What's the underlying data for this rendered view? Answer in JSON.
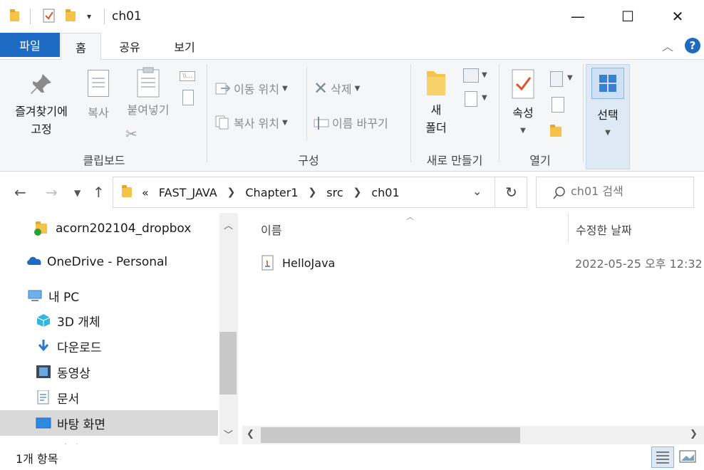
{
  "window": {
    "title": "ch01",
    "minimize": "—",
    "maximize": "☐",
    "close": "✕"
  },
  "tabs": {
    "file": "파일",
    "home": "홈",
    "share": "공유",
    "view": "보기",
    "help": "?"
  },
  "ribbon": {
    "clipboard": {
      "label": "클립보드",
      "pin": "즐겨찾기에\n고정",
      "copy": "복사",
      "paste": "붙여넣기"
    },
    "organize": {
      "label": "구성",
      "move_to": "이동 위치",
      "copy_to": "복사 위치",
      "delete": "삭제",
      "rename": "이름 바꾸기"
    },
    "new": {
      "label": "새로 만들기",
      "new_folder": "새\n폴더"
    },
    "open": {
      "label": "열기",
      "properties": "속성"
    },
    "select": {
      "label": "선택"
    }
  },
  "address": {
    "overflow": "«",
    "crumbs": [
      "FAST_JAVA",
      "Chapter1",
      "src",
      "ch01"
    ],
    "search_placeholder": "ch01 검색"
  },
  "nav": {
    "items": [
      {
        "label": "acorn202104_dropbox",
        "icon": "shared-folder-icon"
      },
      {
        "label": "OneDrive - Personal",
        "icon": "onedrive-icon"
      },
      {
        "label": "내 PC",
        "icon": "pc-icon"
      },
      {
        "label": "3D 개체",
        "icon": "3d-objects-icon"
      },
      {
        "label": "다운로드",
        "icon": "download-icon"
      },
      {
        "label": "동영상",
        "icon": "video-icon"
      },
      {
        "label": "문서",
        "icon": "documents-icon"
      },
      {
        "label": "바탕 화면",
        "icon": "desktop-icon"
      },
      {
        "label": "사진",
        "icon": "pictures-icon"
      }
    ]
  },
  "content": {
    "columns": {
      "name": "이름",
      "modified": "수정한 날짜"
    },
    "files": [
      {
        "name": "HelloJava",
        "modified": "2022-05-25 오후 12:32"
      }
    ]
  },
  "status": {
    "count": "1개 항목"
  },
  "colors": {
    "accent": "#1e6bc4",
    "folder": "#f3c34a",
    "selected": "#d9d9d9"
  }
}
